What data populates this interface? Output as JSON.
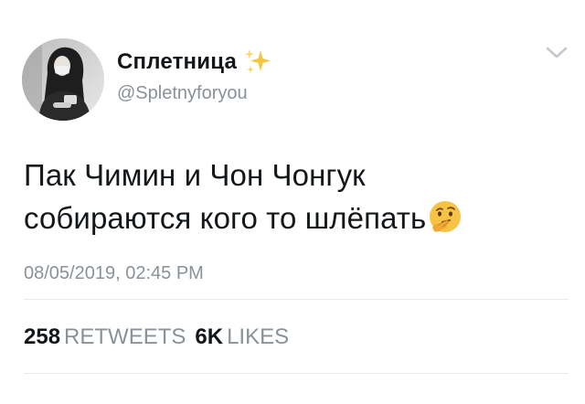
{
  "header": {
    "display_name": "Сплетница",
    "name_emoji": "sparkles-icon",
    "handle": "@Spletnyforyou",
    "menu_icon": "chevron-down-icon"
  },
  "tweet": {
    "text_line1": "Пак Чимин и Чон Чонгук",
    "text_line2": "собираются кого то шлёпать",
    "text_emoji": "thinking-face-icon",
    "timestamp": "08/05/2019, 02:45 PM"
  },
  "stats": {
    "retweets_count": "258",
    "retweets_label": "RETWEETS",
    "likes_count": "6K",
    "likes_label": "LIKES"
  },
  "colors": {
    "text": "#14171a",
    "secondary": "#8a9199",
    "divider": "#e6ecf0",
    "sparkle": "#f4c542"
  }
}
